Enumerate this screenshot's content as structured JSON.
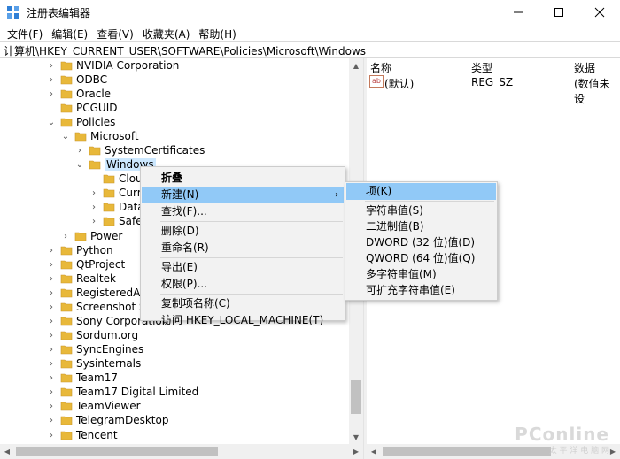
{
  "window": {
    "title": "注册表编辑器",
    "minimize_icon": "minimize-icon",
    "maximize_icon": "maximize-icon",
    "close_icon": "close-icon"
  },
  "menubar": {
    "items": [
      "文件(F)",
      "编辑(E)",
      "查看(V)",
      "收藏夹(A)",
      "帮助(H)"
    ]
  },
  "address": {
    "path": "计算机\\HKEY_CURRENT_USER\\SOFTWARE\\Policies\\Microsoft\\Windows"
  },
  "tree": {
    "items": [
      {
        "label": "NVIDIA Corporation",
        "expander": "collapsed"
      },
      {
        "label": "ODBC",
        "expander": "collapsed"
      },
      {
        "label": "Oracle",
        "expander": "collapsed"
      },
      {
        "label": "PCGUID",
        "expander": "none"
      },
      {
        "label": "Policies",
        "expander": "expanded"
      },
      {
        "label": "Microsoft",
        "expander": "expanded"
      },
      {
        "label": "SystemCertificates",
        "expander": "collapsed"
      },
      {
        "label": "Windows",
        "expander": "expanded"
      },
      {
        "label": "Clouc",
        "expander": "none"
      },
      {
        "label": "Curre",
        "expander": "collapsed"
      },
      {
        "label": "DataC",
        "expander": "collapsed"
      },
      {
        "label": "Safer",
        "expander": "collapsed"
      },
      {
        "label": "Power",
        "expander": "collapsed"
      },
      {
        "label": "Python",
        "expander": "collapsed"
      },
      {
        "label": "QtProject",
        "expander": "collapsed"
      },
      {
        "label": "Realtek",
        "expander": "collapsed"
      },
      {
        "label": "RegisteredApp",
        "expander": "collapsed"
      },
      {
        "label": "Screenshot St",
        "expander": "collapsed"
      },
      {
        "label": "Sony Corporation",
        "expander": "collapsed"
      },
      {
        "label": "Sordum.org",
        "expander": "collapsed"
      },
      {
        "label": "SyncEngines",
        "expander": "collapsed"
      },
      {
        "label": "Sysinternals",
        "expander": "collapsed"
      },
      {
        "label": "Team17",
        "expander": "collapsed"
      },
      {
        "label": "Team17 Digital Limited",
        "expander": "collapsed"
      },
      {
        "label": "TeamViewer",
        "expander": "collapsed"
      },
      {
        "label": "TelegramDesktop",
        "expander": "collapsed"
      },
      {
        "label": "Tencent",
        "expander": "collapsed"
      }
    ],
    "selected": "Windows"
  },
  "values": {
    "headers": {
      "name": "名称",
      "type": "类型",
      "data": "数据"
    },
    "rows": [
      {
        "name": "(默认)",
        "type": "REG_SZ",
        "data": "(数值未设"
      }
    ]
  },
  "context_menu": {
    "items": [
      {
        "label": "折叠",
        "bold": true
      },
      {
        "label": "新建(N)",
        "submenu": true,
        "highlight": true
      },
      {
        "label": "查找(F)..."
      },
      {
        "sep": true
      },
      {
        "label": "删除(D)"
      },
      {
        "label": "重命名(R)"
      },
      {
        "sep": true
      },
      {
        "label": "导出(E)"
      },
      {
        "label": "权限(P)..."
      },
      {
        "sep": true
      },
      {
        "label": "复制项名称(C)"
      },
      {
        "label": "访问 HKEY_LOCAL_MACHINE(T)"
      }
    ]
  },
  "submenu": {
    "items": [
      {
        "label": "项(K)",
        "highlight": true
      },
      {
        "sep": true
      },
      {
        "label": "字符串值(S)"
      },
      {
        "label": "二进制值(B)"
      },
      {
        "label": "DWORD (32 位)值(D)"
      },
      {
        "label": "QWORD (64 位)值(Q)"
      },
      {
        "label": "多字符串值(M)"
      },
      {
        "label": "可扩充字符串值(E)"
      }
    ]
  },
  "watermark": {
    "text": "PConline",
    "sub": "太 平 洋 电 脑 网"
  },
  "colors": {
    "selection": "#cce8ff",
    "menu_highlight": "#91c9f7",
    "folder": "#e8b83a"
  }
}
